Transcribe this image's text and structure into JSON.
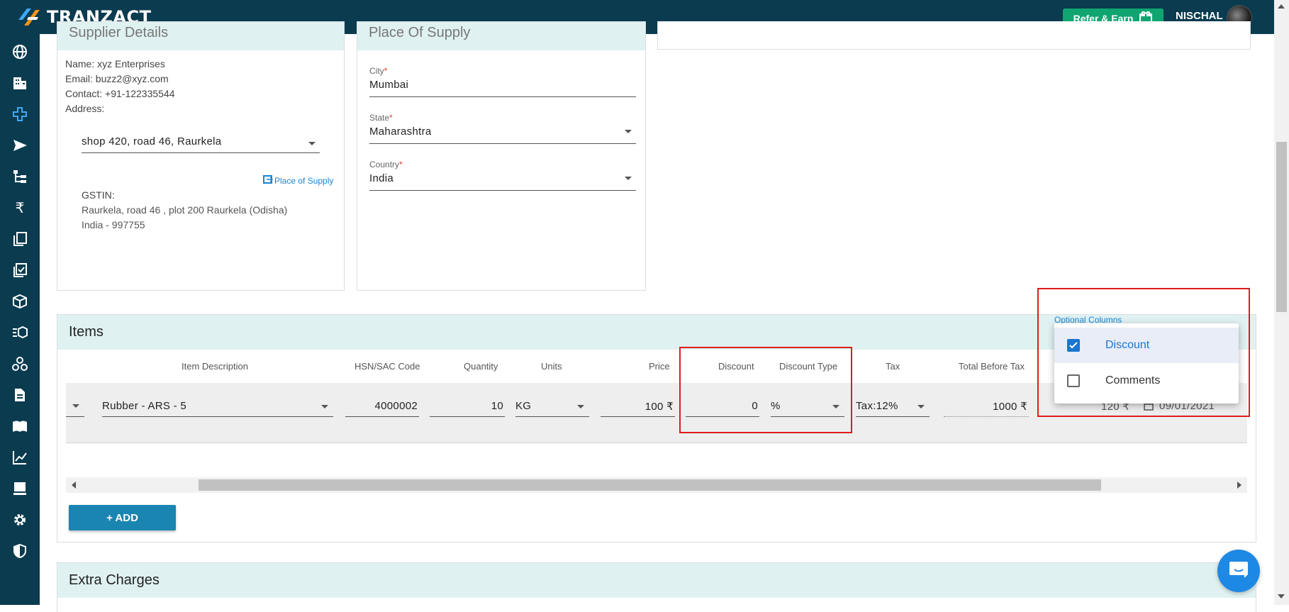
{
  "topbar": {
    "brand": "TRANZACT",
    "refer_label": "Refer & Earn",
    "user_name": "NISCHAL"
  },
  "sidebar": {
    "icons": [
      "globe-icon",
      "building-icon",
      "plus-cross-icon",
      "send-icon",
      "hierarchy-icon",
      "rupee-icon",
      "documents-icon",
      "checklist-icon",
      "box-icon",
      "list-box-icon",
      "network-icon",
      "file-icon",
      "book-icon",
      "chart-icon",
      "monitor-icon",
      "gear-icon",
      "shield-icon"
    ]
  },
  "supplier": {
    "title": "Supplier Details",
    "name_label": "Name:",
    "name_value": "xyz Enterprises",
    "email_label": "Email:",
    "email_value": "buzz2@xyz.com",
    "contact_label": "Contact:",
    "contact_value": "+91-122335544",
    "address_label": "Address:",
    "address_select": "shop 420, road 46, Raurkela",
    "place_of_supply_link": "Place of Supply",
    "gstin_label": "GSTIN:",
    "address_line1": "Raurkela, road 46 , plot 200 Raurkela (Odisha)",
    "address_line2": "India - 997755"
  },
  "place_of_supply": {
    "title": "Place Of Supply",
    "city_label": "City",
    "city_value": "Mumbai",
    "state_label": "State",
    "state_value": "Maharashtra",
    "country_label": "Country",
    "country_value": "India",
    "required_mark": "*"
  },
  "items": {
    "title": "Items",
    "optional_columns_label": "Optional Columns",
    "columns": {
      "item_description": "Item Description",
      "hsn": "HSN/SAC Code",
      "quantity": "Quantity",
      "units": "Units",
      "price": "Price",
      "discount": "Discount",
      "discount_type": "Discount Type",
      "tax": "Tax",
      "total_before_tax": "Total Before Tax"
    },
    "row": {
      "item": "Rubber - ARS - 5",
      "hsn": "4000002",
      "quantity": "10",
      "units": "KG",
      "price": "100 ₹",
      "discount": "0",
      "discount_type": "%",
      "tax": "Tax:12%",
      "total_before_tax": "1000 ₹",
      "tax_amount": "120 ₹",
      "date": "09/01/2021"
    },
    "add_label": "+ ADD"
  },
  "optional_columns_menu": {
    "options": [
      {
        "label": "Discount",
        "checked": true
      },
      {
        "label": "Comments",
        "checked": false
      }
    ]
  },
  "extra_charges": {
    "title": "Extra Charges"
  },
  "colors": {
    "topbar": "#0a3b4f",
    "section_header": "#e0f1f1",
    "accent": "#1a85b0",
    "refer": "#10a570",
    "highlight": "#e01b1b"
  }
}
